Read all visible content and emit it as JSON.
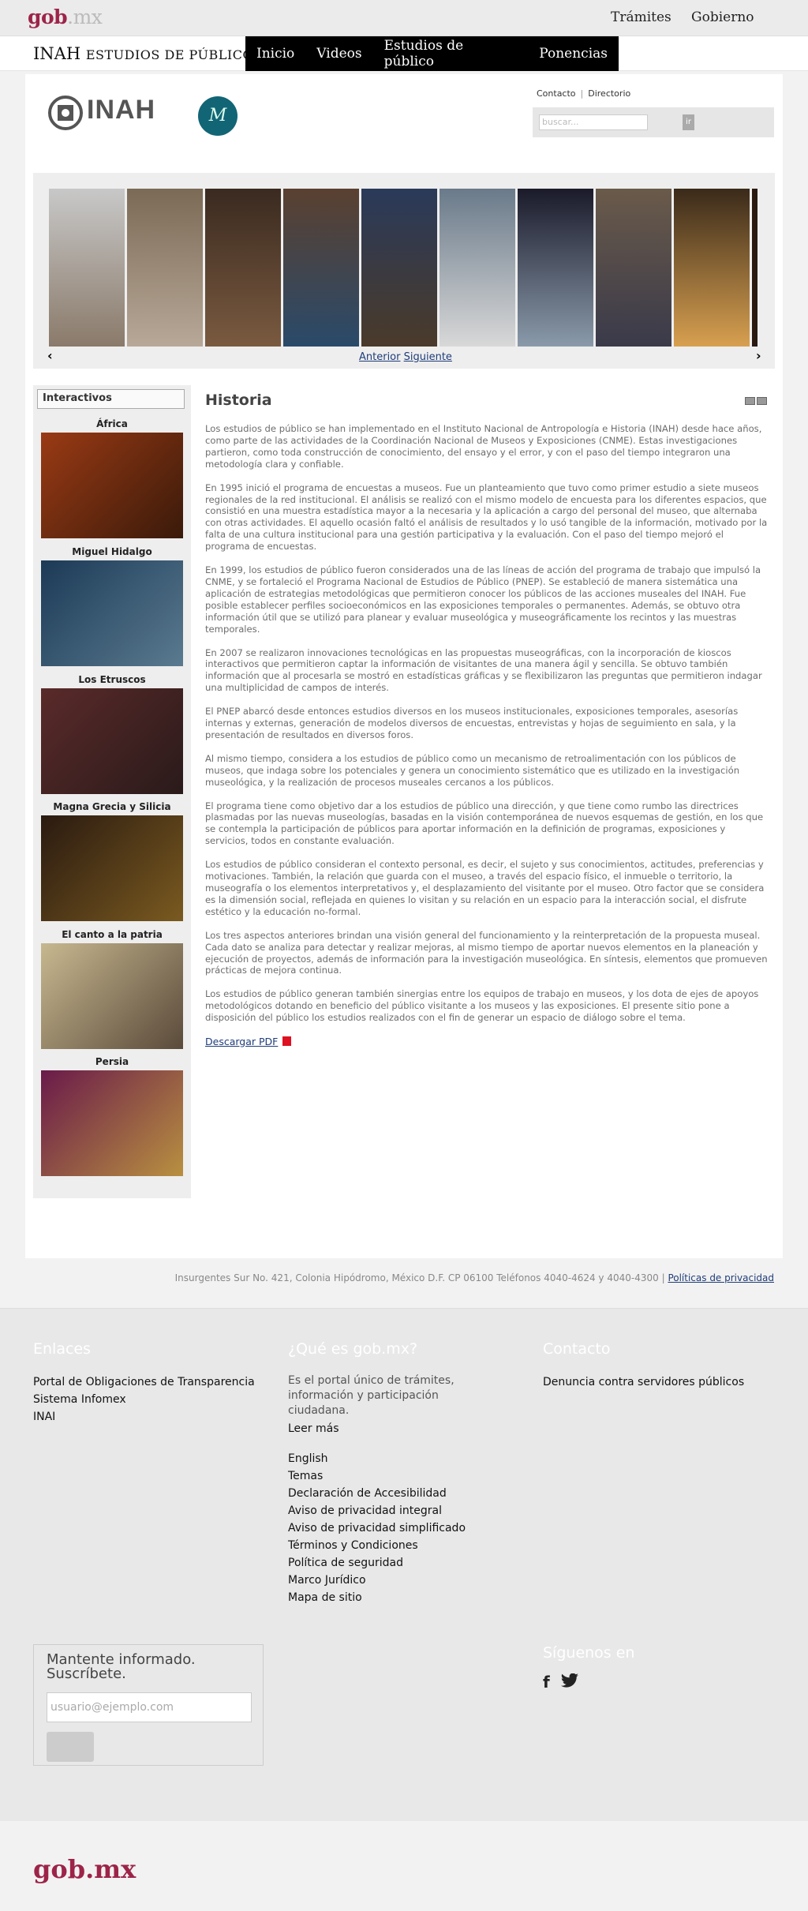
{
  "topbar": {
    "logo_gob": "gob",
    "logo_mx": ".mx",
    "nav": [
      "Trámites",
      "Gobierno"
    ]
  },
  "site": {
    "title_main": "INAH",
    "title_sub": "ESTUDIOS DE PÚBLICO",
    "nav": [
      "Inicio",
      "Videos",
      "Estudios de público",
      "Ponencias"
    ]
  },
  "header": {
    "logo_text": "INAH",
    "circle_logo": "M",
    "links": [
      "Contacto",
      "Directorio"
    ],
    "search_placeholder": "buscar...",
    "search_button": "ir"
  },
  "gallery": {
    "prev": "Anterior",
    "next": "Siguiente",
    "thumb_colors": [
      "#8a7a6a",
      "#7b6a55",
      "#3a2a20",
      "#5a4030",
      "#2a3a5a",
      "#6a7a8a",
      "#2a2a3a",
      "#6a5a4a",
      "#3a2a1a",
      "#4a3a2a"
    ]
  },
  "sidebar": {
    "heading": "Interactivos",
    "items": [
      {
        "title": "África",
        "color": "#9a3a14"
      },
      {
        "title": "Miguel Hidalgo",
        "color": "#1c3a56"
      },
      {
        "title": "Los Etruscos",
        "color": "#5a2a2a"
      },
      {
        "title": "Magna Grecia y Silicia",
        "color": "#2a1a10"
      },
      {
        "title": "El canto a la patria",
        "color": "#7a6a4a"
      },
      {
        "title": "Persia",
        "color": "#6a1a4a"
      }
    ]
  },
  "main": {
    "title": "Historia",
    "paragraphs": [
      "Los estudios de público se han implementado en el Instituto Nacional de Antropología e Historia (INAH) desde hace años, como parte de las actividades de la Coordinación Nacional de Museos y Exposiciones (CNME). Estas investigaciones partieron, como toda construcción de conocimiento, del ensayo y el error, y con el paso del tiempo integraron una metodología clara y confiable.",
      "En 1995 inició el programa de encuestas a museos. Fue un planteamiento que tuvo como primer estudio a siete museos regionales de la red institucional. El análisis se realizó con el mismo modelo de encuesta para los diferentes espacios, que consistió en una muestra estadística mayor a la necesaria y la aplicación a cargo del personal del museo, que alternaba con otras actividades. El aquello ocasión faltó el análisis de resultados y lo usó tangible de la información, motivado por la falta de una cultura institucional para una gestión participativa y la evaluación. Con el paso del tiempo mejoró el programa de encuestas.",
      "En 1999, los estudios de público fueron considerados una de las líneas de acción del programa de trabajo que impulsó la CNME, y se fortaleció el Programa Nacional de Estudios de Público (PNEP). Se estableció de manera sistemática una aplicación de estrategias metodológicas que permitieron conocer los públicos de las acciones museales del INAH. Fue posible establecer perfiles socioeconómicos en las exposiciones temporales o permanentes. Además, se obtuvo otra información útil que se utilizó para planear y evaluar museológica y museográficamente los recintos y las muestras temporales.",
      "En 2007 se realizaron innovaciones tecnológicas en las propuestas museográficas, con la incorporación de kioscos interactivos que permitieron captar la información de visitantes de una manera ágil y sencilla. Se obtuvo también información que al procesarla se mostró en estadísticas gráficas y se flexibilizaron las preguntas que permitieron indagar una multiplicidad de campos de interés.",
      "El PNEP abarcó desde entonces estudios diversos en los museos institucionales, exposiciones temporales, asesorías internas y externas, generación de modelos diversos de encuestas, entrevistas y hojas de seguimiento en sala, y la presentación de resultados en diversos foros.",
      "Al mismo tiempo, considera a los estudios de público como un mecanismo de retroalimentación con los públicos de museos, que indaga sobre los potenciales y genera un conocimiento sistemático que es utilizado en la investigación museológica, y la realización de procesos museales cercanos a los públicos.",
      "El programa tiene como objetivo dar a los estudios de público una dirección, y que tiene como rumbo las directrices plasmadas por las nuevas museologías, basadas en la visión contemporánea de nuevos esquemas de gestión, en los que se contempla la participación de públicos para aportar información en la definición de programas, exposiciones y servicios, todos en constante evaluación.",
      "Los estudios de público consideran el contexto personal, es decir, el sujeto y sus conocimientos, actitudes, preferencias y motivaciones. También, la relación que guarda con el museo, a través del espacio físico, el inmueble o territorio, la museografía o los elementos interpretativos y, el desplazamiento del visitante por el museo. Otro factor que se considera es la dimensión social, reflejada en quienes lo visitan y su relación en un espacio para la interacción social, el disfrute estético y la educación no-formal.",
      "Los tres aspectos anteriores brindan una visión general del funcionamiento y la reinterpretación de la propuesta museal. Cada dato se analiza para detectar y realizar mejoras, al mismo tiempo de aportar nuevos elementos en la planeación y ejecución de proyectos, además de información para la investigación museológica. En síntesis, elementos que promueven prácticas de mejora continua.",
      "Los estudios de público generan también sinergias entre los equipos de trabajo en museos, y los dota de ejes de apoyos metodológicos dotando en beneficio del público visitante a los museos y las exposiciones. El presente sitio pone a disposición del público los estudios realizados con el fin de generar un espacio de diálogo sobre el tema."
    ],
    "download": "Descargar PDF"
  },
  "address": {
    "text": "Insurgentes Sur No. 421, Colonia Hipódromo, México D.F. CP 06100 Teléfonos 4040-4624 y 4040-4300 |",
    "privacy": "Políticas de privacidad"
  },
  "footer": {
    "enlaces": {
      "heading": "Enlaces",
      "links": [
        "Portal de Obligaciones de Transparencia",
        "Sistema Infomex",
        "INAI"
      ]
    },
    "que_es": {
      "heading": "¿Qué es gob.mx?",
      "desc": "Es el portal único de trámites, información y participación ciudadana.",
      "more": "Leer más",
      "links": [
        "English",
        "Temas",
        "Declaración de Accesibilidad",
        "Aviso de privacidad integral",
        "Aviso de privacidad simplificado",
        "Términos y Condiciones",
        "Política de seguridad",
        "Marco Jurídico",
        "Mapa de sitio"
      ]
    },
    "contacto": {
      "heading": "Contacto",
      "links": [
        "Denuncia contra servidores públicos"
      ]
    },
    "newsletter": {
      "title_1": "Mantente informado.",
      "title_2": "Suscríbete.",
      "placeholder": "usuario@ejemplo.com"
    },
    "follow": {
      "heading": "Síguenos en",
      "facebook": "f",
      "twitter": "🐦"
    }
  },
  "bottom": {
    "logo": "gob.mx"
  }
}
